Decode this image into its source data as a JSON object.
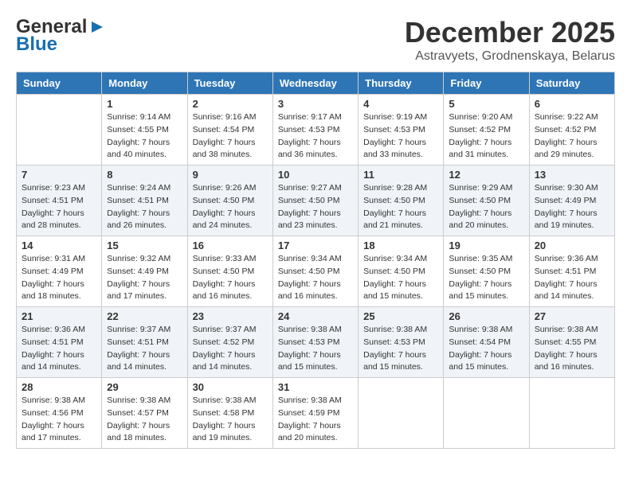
{
  "header": {
    "logo_general": "General",
    "logo_blue": "Blue",
    "month": "December 2025",
    "location": "Astravyets, Grodnenskaya, Belarus"
  },
  "weekdays": [
    "Sunday",
    "Monday",
    "Tuesday",
    "Wednesday",
    "Thursday",
    "Friday",
    "Saturday"
  ],
  "weeks": [
    [
      {
        "day": "",
        "sunrise": "",
        "sunset": "",
        "daylight": ""
      },
      {
        "day": "1",
        "sunrise": "9:14 AM",
        "sunset": "4:55 PM",
        "daylight": "7 hours and 40 minutes."
      },
      {
        "day": "2",
        "sunrise": "9:16 AM",
        "sunset": "4:54 PM",
        "daylight": "7 hours and 38 minutes."
      },
      {
        "day": "3",
        "sunrise": "9:17 AM",
        "sunset": "4:53 PM",
        "daylight": "7 hours and 36 minutes."
      },
      {
        "day": "4",
        "sunrise": "9:19 AM",
        "sunset": "4:53 PM",
        "daylight": "7 hours and 33 minutes."
      },
      {
        "day": "5",
        "sunrise": "9:20 AM",
        "sunset": "4:52 PM",
        "daylight": "7 hours and 31 minutes."
      },
      {
        "day": "6",
        "sunrise": "9:22 AM",
        "sunset": "4:52 PM",
        "daylight": "7 hours and 29 minutes."
      }
    ],
    [
      {
        "day": "7",
        "sunrise": "9:23 AM",
        "sunset": "4:51 PM",
        "daylight": "7 hours and 28 minutes."
      },
      {
        "day": "8",
        "sunrise": "9:24 AM",
        "sunset": "4:51 PM",
        "daylight": "7 hours and 26 minutes."
      },
      {
        "day": "9",
        "sunrise": "9:26 AM",
        "sunset": "4:50 PM",
        "daylight": "7 hours and 24 minutes."
      },
      {
        "day": "10",
        "sunrise": "9:27 AM",
        "sunset": "4:50 PM",
        "daylight": "7 hours and 23 minutes."
      },
      {
        "day": "11",
        "sunrise": "9:28 AM",
        "sunset": "4:50 PM",
        "daylight": "7 hours and 21 minutes."
      },
      {
        "day": "12",
        "sunrise": "9:29 AM",
        "sunset": "4:50 PM",
        "daylight": "7 hours and 20 minutes."
      },
      {
        "day": "13",
        "sunrise": "9:30 AM",
        "sunset": "4:49 PM",
        "daylight": "7 hours and 19 minutes."
      }
    ],
    [
      {
        "day": "14",
        "sunrise": "9:31 AM",
        "sunset": "4:49 PM",
        "daylight": "7 hours and 18 minutes."
      },
      {
        "day": "15",
        "sunrise": "9:32 AM",
        "sunset": "4:49 PM",
        "daylight": "7 hours and 17 minutes."
      },
      {
        "day": "16",
        "sunrise": "9:33 AM",
        "sunset": "4:50 PM",
        "daylight": "7 hours and 16 minutes."
      },
      {
        "day": "17",
        "sunrise": "9:34 AM",
        "sunset": "4:50 PM",
        "daylight": "7 hours and 16 minutes."
      },
      {
        "day": "18",
        "sunrise": "9:34 AM",
        "sunset": "4:50 PM",
        "daylight": "7 hours and 15 minutes."
      },
      {
        "day": "19",
        "sunrise": "9:35 AM",
        "sunset": "4:50 PM",
        "daylight": "7 hours and 15 minutes."
      },
      {
        "day": "20",
        "sunrise": "9:36 AM",
        "sunset": "4:51 PM",
        "daylight": "7 hours and 14 minutes."
      }
    ],
    [
      {
        "day": "21",
        "sunrise": "9:36 AM",
        "sunset": "4:51 PM",
        "daylight": "7 hours and 14 minutes."
      },
      {
        "day": "22",
        "sunrise": "9:37 AM",
        "sunset": "4:51 PM",
        "daylight": "7 hours and 14 minutes."
      },
      {
        "day": "23",
        "sunrise": "9:37 AM",
        "sunset": "4:52 PM",
        "daylight": "7 hours and 14 minutes."
      },
      {
        "day": "24",
        "sunrise": "9:38 AM",
        "sunset": "4:53 PM",
        "daylight": "7 hours and 15 minutes."
      },
      {
        "day": "25",
        "sunrise": "9:38 AM",
        "sunset": "4:53 PM",
        "daylight": "7 hours and 15 minutes."
      },
      {
        "day": "26",
        "sunrise": "9:38 AM",
        "sunset": "4:54 PM",
        "daylight": "7 hours and 15 minutes."
      },
      {
        "day": "27",
        "sunrise": "9:38 AM",
        "sunset": "4:55 PM",
        "daylight": "7 hours and 16 minutes."
      }
    ],
    [
      {
        "day": "28",
        "sunrise": "9:38 AM",
        "sunset": "4:56 PM",
        "daylight": "7 hours and 17 minutes."
      },
      {
        "day": "29",
        "sunrise": "9:38 AM",
        "sunset": "4:57 PM",
        "daylight": "7 hours and 18 minutes."
      },
      {
        "day": "30",
        "sunrise": "9:38 AM",
        "sunset": "4:58 PM",
        "daylight": "7 hours and 19 minutes."
      },
      {
        "day": "31",
        "sunrise": "9:38 AM",
        "sunset": "4:59 PM",
        "daylight": "7 hours and 20 minutes."
      },
      {
        "day": "",
        "sunrise": "",
        "sunset": "",
        "daylight": ""
      },
      {
        "day": "",
        "sunrise": "",
        "sunset": "",
        "daylight": ""
      },
      {
        "day": "",
        "sunrise": "",
        "sunset": "",
        "daylight": ""
      }
    ]
  ]
}
